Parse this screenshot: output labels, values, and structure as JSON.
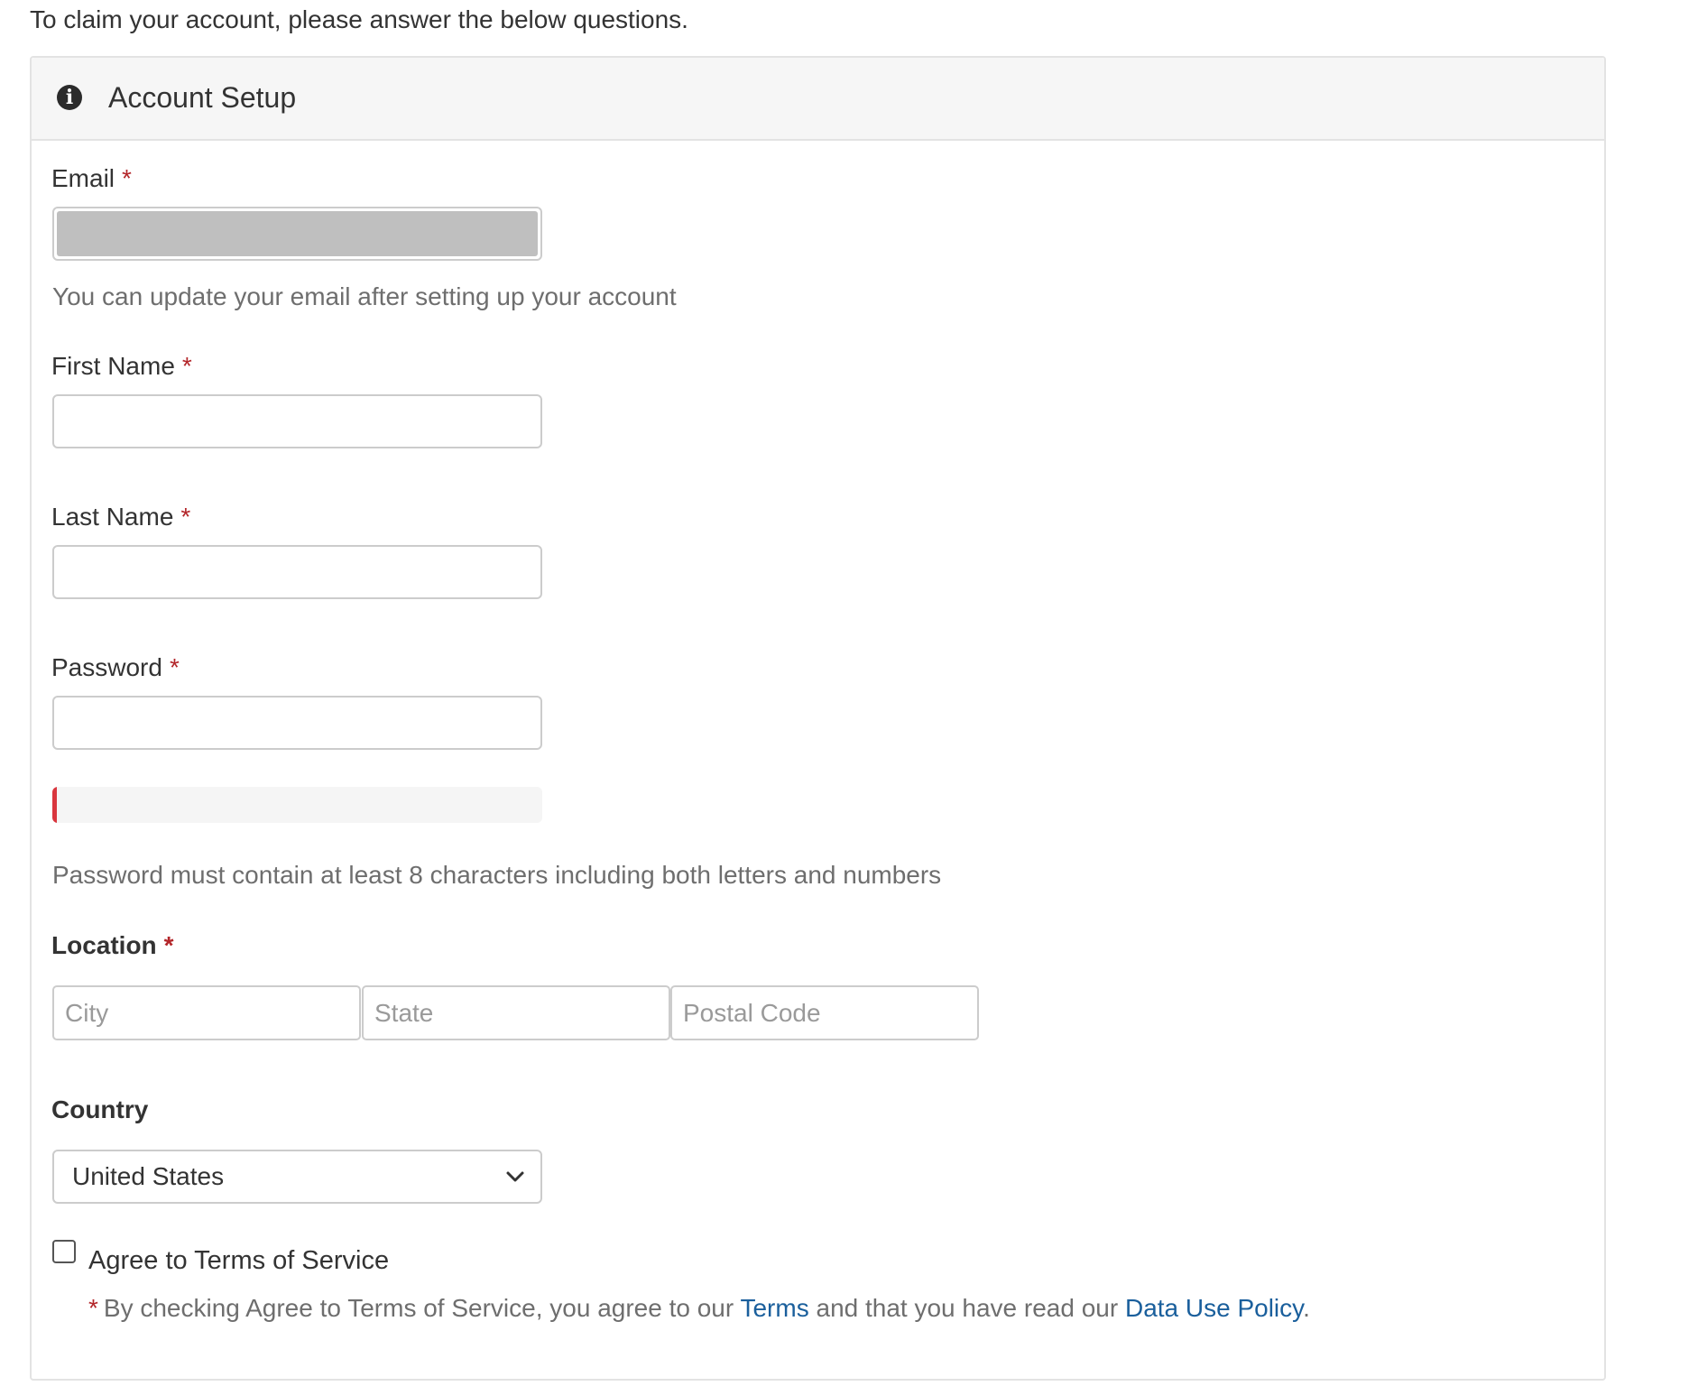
{
  "intro_text": "To claim your account, please answer the below questions.",
  "panel": {
    "icon": "info-circle-icon",
    "title": "Account Setup"
  },
  "fields": {
    "email": {
      "label": "Email",
      "required_mark": "*",
      "value": "",
      "help": "You can update your email after setting up your account"
    },
    "first_name": {
      "label": "First Name",
      "required_mark": "*",
      "value": ""
    },
    "last_name": {
      "label": "Last Name",
      "required_mark": "*",
      "value": ""
    },
    "password": {
      "label": "Password",
      "required_mark": "*",
      "value": "",
      "strength_fraction": 0.01,
      "help": "Password must contain at least 8 characters including both letters and numbers"
    },
    "location": {
      "label": "Location",
      "required_mark": "*",
      "city_placeholder": "City",
      "state_placeholder": "State",
      "postal_placeholder": "Postal Code"
    },
    "country": {
      "label": "Country",
      "selected": "United States"
    }
  },
  "terms": {
    "checkbox_label": "Agree to Terms of Service",
    "checked": false,
    "note_mark": "*",
    "note_before": "By checking Agree to Terms of Service, you agree to our ",
    "terms_link": "Terms",
    "note_middle": " and that you have read our ",
    "policy_link": "Data Use Policy",
    "note_end": "."
  },
  "colors": {
    "required": "#b3262a",
    "link": "#1a5f9c",
    "strength_weak": "#d9363e",
    "heading_bg": "#f6f6f6"
  }
}
